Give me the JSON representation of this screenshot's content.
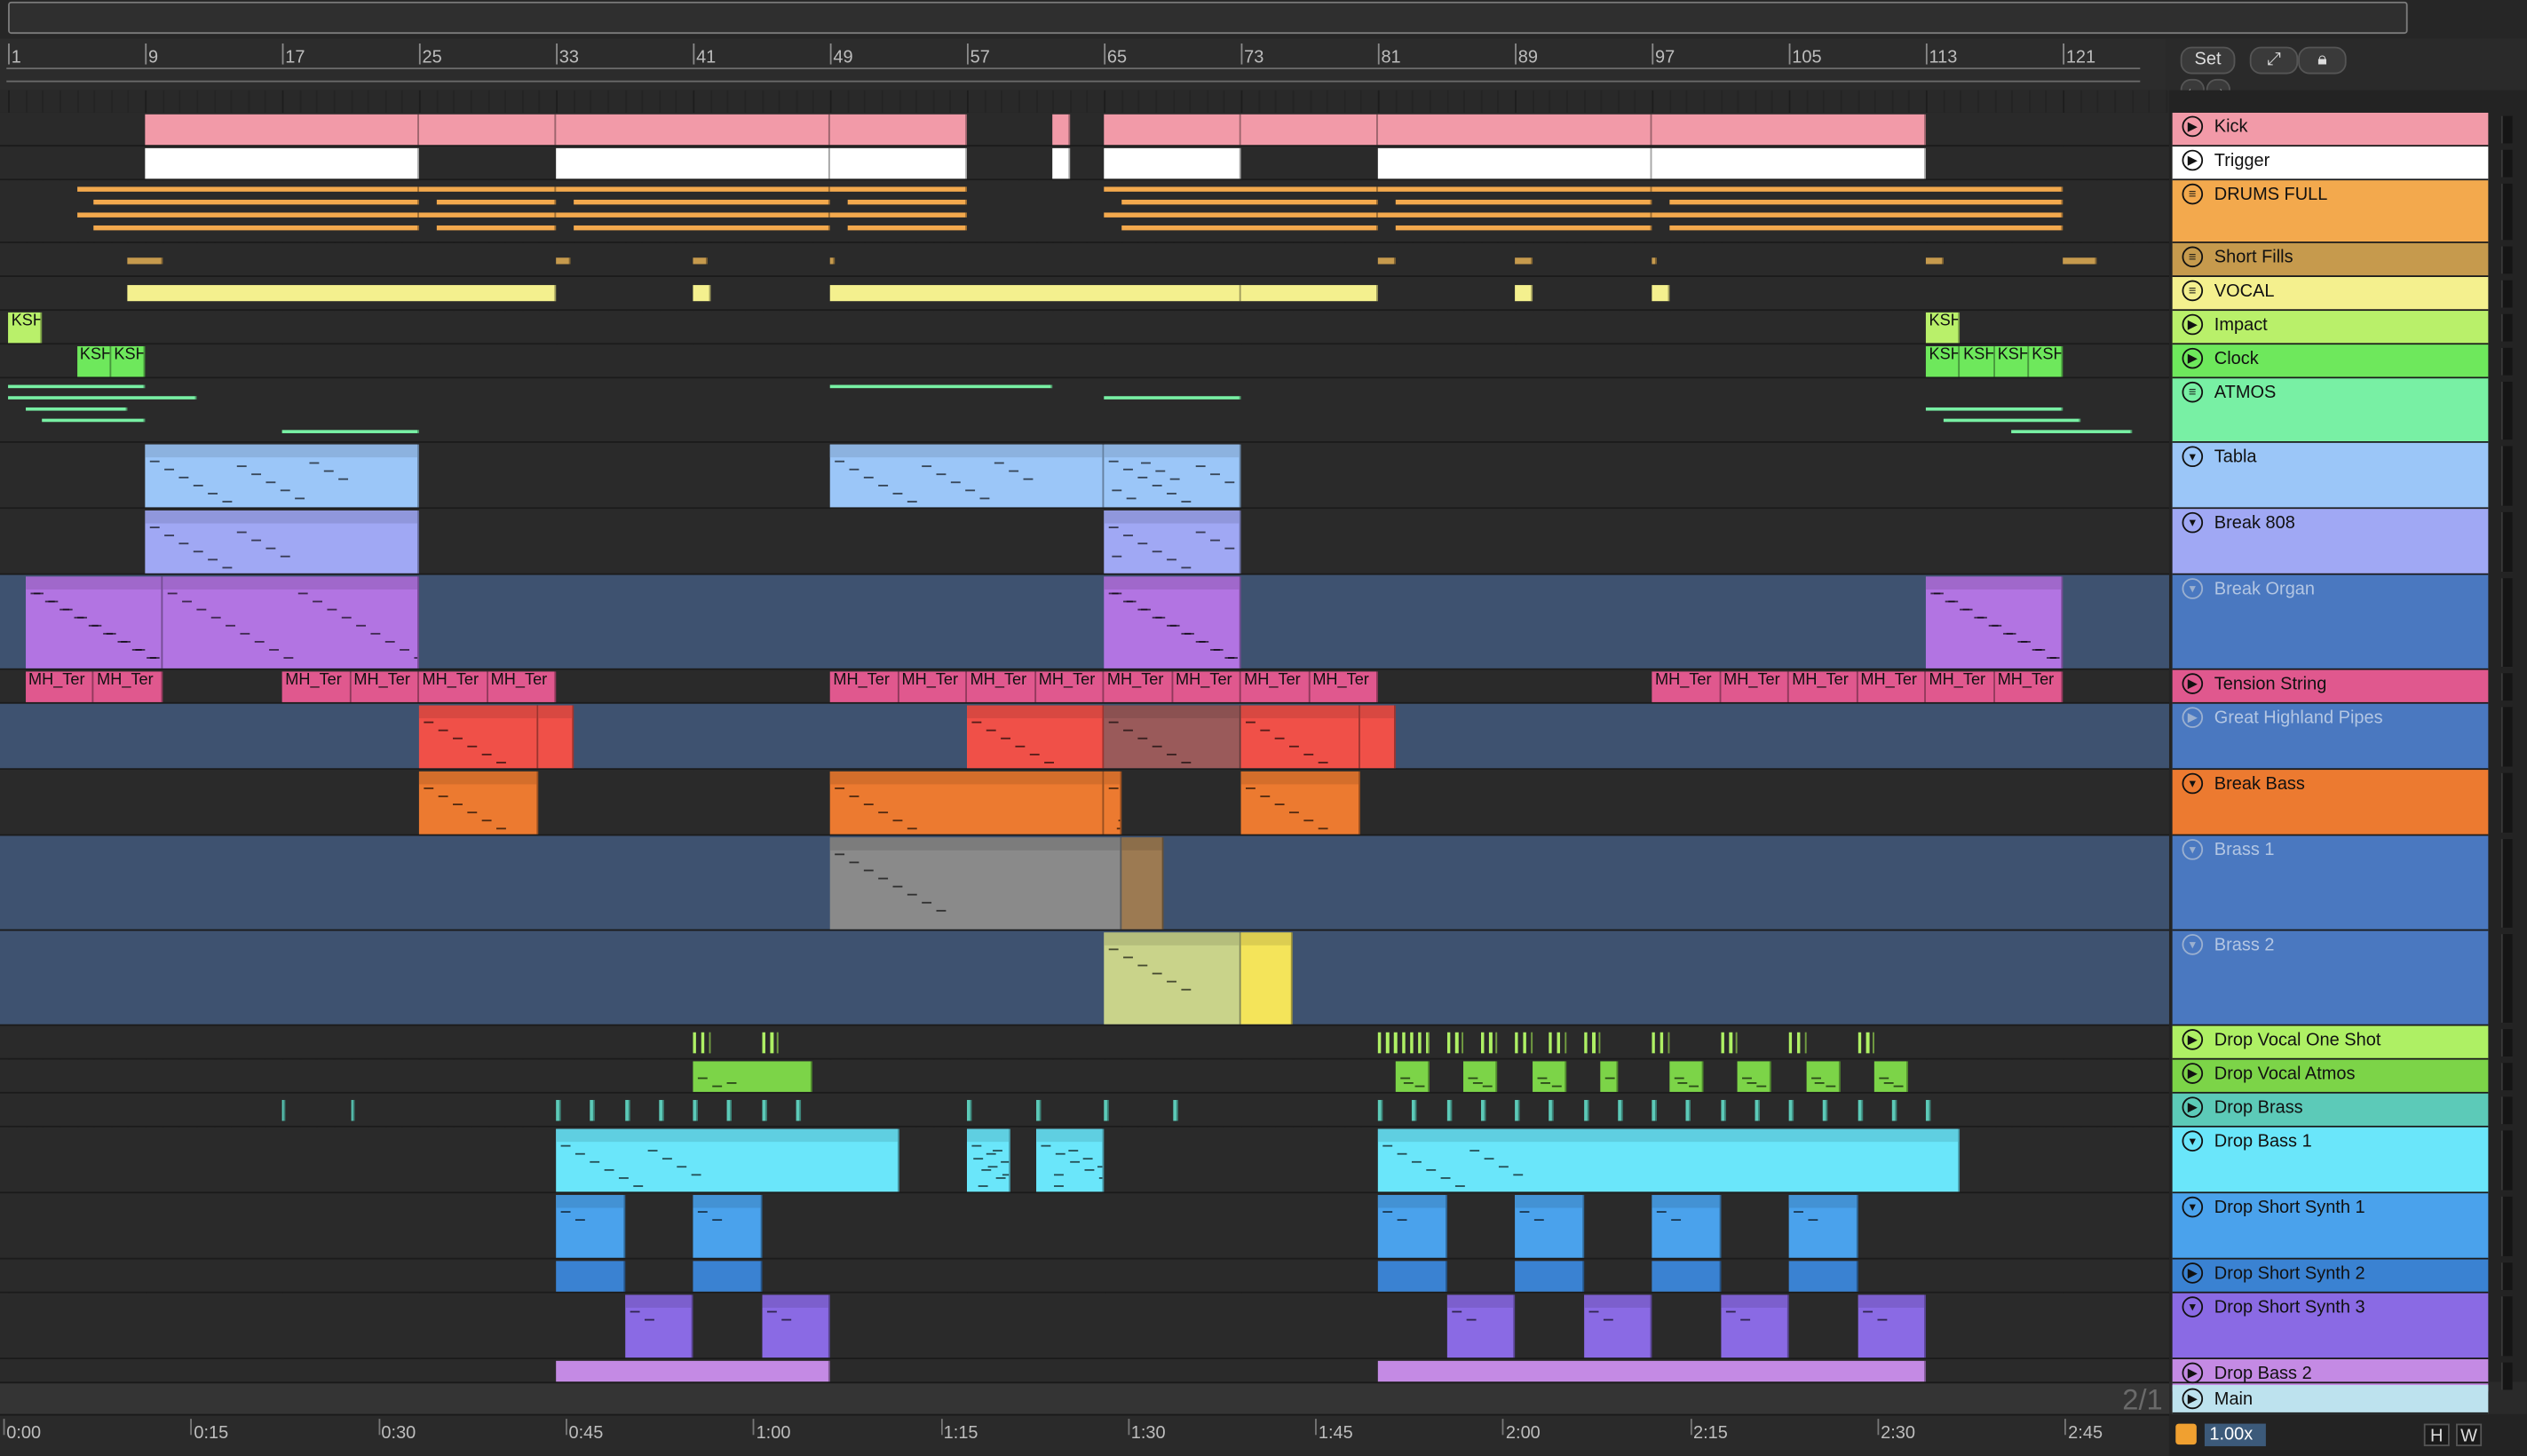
{
  "ruler": {
    "bars": [
      "1",
      "9",
      "17",
      "25",
      "33",
      "41",
      "49",
      "57",
      "65",
      "73",
      "81",
      "89",
      "97",
      "105",
      "113",
      "121"
    ]
  },
  "set_controls": {
    "set_label": "Set",
    "expand_icon": "expand-icon",
    "lock_icon": "lock-icon",
    "prev_icon": "arrow-left-icon",
    "next_icon": "arrow-right-icon"
  },
  "tracks": [
    {
      "name": "Kick",
      "color": "#f29aa8",
      "icon": "play"
    },
    {
      "name": "Trigger",
      "color": "#ffffff",
      "icon": "play"
    },
    {
      "name": "DRUMS FULL",
      "color": "#f3a94d",
      "icon": "group"
    },
    {
      "name": "Short Fills",
      "color": "#c69a4d",
      "icon": "group"
    },
    {
      "name": "VOCAL",
      "color": "#f4f08e",
      "icon": "group"
    },
    {
      "name": "Impact",
      "color": "#b9f06a",
      "icon": "play"
    },
    {
      "name": "Clock",
      "color": "#6ee85c",
      "icon": "play"
    },
    {
      "name": "ATMOS",
      "color": "#78f0a4",
      "icon": "group"
    },
    {
      "name": "Tabla",
      "color": "#9bc6f8",
      "icon": "fold"
    },
    {
      "name": "Break 808",
      "color": "#a0a8f4",
      "icon": "fold"
    },
    {
      "name": "Break Organ",
      "color": "#b274e2",
      "icon": "fold",
      "dim": true
    },
    {
      "name": "Tension String",
      "color": "#e0588e",
      "icon": "play"
    },
    {
      "name": "Great Highland Pipes",
      "color": "#f05048",
      "icon": "play",
      "dim": true
    },
    {
      "name": "Break Bass",
      "color": "#ec7a30",
      "icon": "fold"
    },
    {
      "name": "Brass 1",
      "color": "#9c7a52",
      "icon": "fold",
      "dim": true
    },
    {
      "name": "Brass 2",
      "color": "#f4e45a",
      "icon": "fold",
      "dim": true
    },
    {
      "name": "Drop Vocal One Shot",
      "color": "#aef064",
      "icon": "play"
    },
    {
      "name": "Drop Vocal Atmos",
      "color": "#7cd448",
      "icon": "play"
    },
    {
      "name": "Drop Brass",
      "color": "#5ccab8",
      "icon": "play"
    },
    {
      "name": "Drop Bass 1",
      "color": "#6ae6fa",
      "icon": "fold"
    },
    {
      "name": "Drop Short Synth 1",
      "color": "#4aa2ec",
      "icon": "fold"
    },
    {
      "name": "Drop Short Synth 2",
      "color": "#3a82d2",
      "icon": "play"
    },
    {
      "name": "Drop Short Synth 3",
      "color": "#8a6ae4",
      "icon": "fold"
    },
    {
      "name": "Drop Bass 2",
      "color": "#c48ae4",
      "icon": "play"
    },
    {
      "name": "Main",
      "color": "#bde2ee",
      "icon": "play"
    }
  ],
  "clip_labels": {
    "ksh": "KSH",
    "mh": "MH_Ter"
  },
  "time_ruler": [
    "0:00",
    "0:15",
    "0:30",
    "0:45",
    "1:00",
    "1:15",
    "1:30",
    "1:45",
    "2:00",
    "2:15",
    "2:30",
    "2:45"
  ],
  "grid_label": "2/1",
  "bottom": {
    "zoom": "1.00x",
    "h_button": "H",
    "w_button": "W"
  }
}
